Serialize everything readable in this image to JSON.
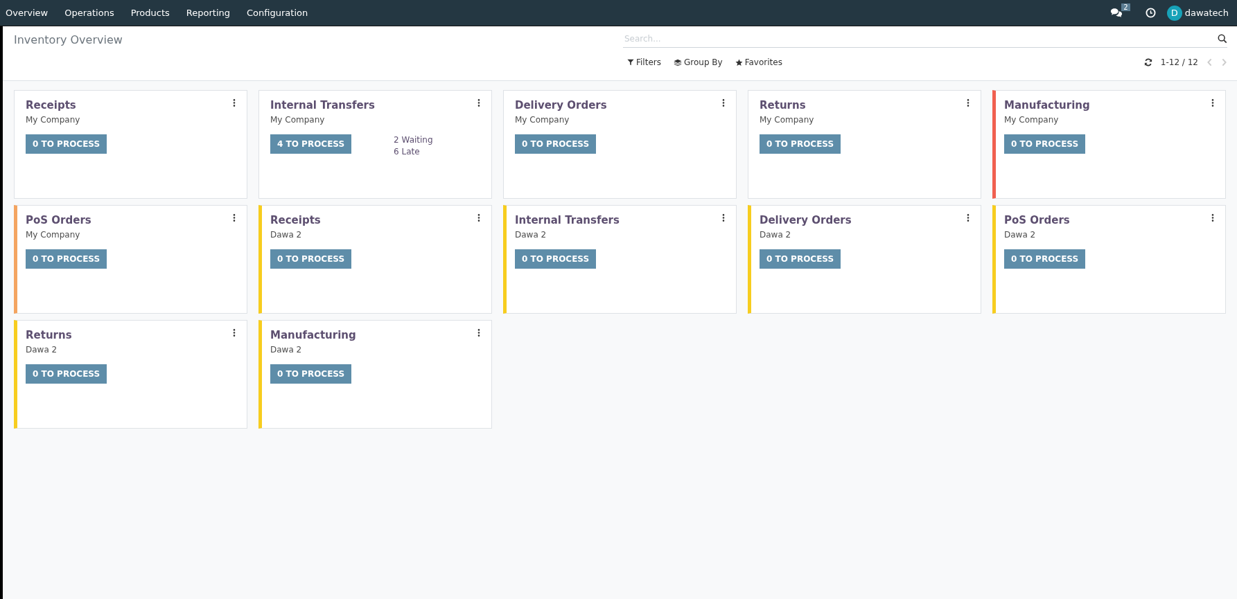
{
  "menu": [
    {
      "label": "Overview"
    },
    {
      "label": "Operations"
    },
    {
      "label": "Products"
    },
    {
      "label": "Reporting"
    },
    {
      "label": "Configuration"
    }
  ],
  "systray": {
    "chat_count": "2",
    "user_initial": "D",
    "user_name": "dawatech"
  },
  "control_panel": {
    "title": "Inventory Overview",
    "search": {
      "placeholder": "Search..."
    },
    "filters": [
      "Filters",
      "Group By",
      "Favorites"
    ],
    "pager": {
      "range": "1-12 / 12",
      "prev_disabled": true,
      "next_disabled": true
    }
  },
  "cards": [
    {
      "title": "Receipts",
      "company": "My Company",
      "button": "0 TO PROCESS"
    },
    {
      "title": "Internal Transfers",
      "company": "My Company",
      "button": "4 TO PROCESS",
      "notes": [
        "2 Waiting",
        "6 Late"
      ]
    },
    {
      "title": "Delivery Orders",
      "company": "My Company",
      "button": "0 TO PROCESS"
    },
    {
      "title": "Returns",
      "company": "My Company",
      "button": "0 TO PROCESS"
    },
    {
      "title": "Manufacturing",
      "company": "My Company",
      "button": "0 TO PROCESS",
      "color": "#f06050"
    },
    {
      "title": "PoS Orders",
      "company": "My Company",
      "button": "0 TO PROCESS",
      "color": "#f4a460"
    },
    {
      "title": "Receipts",
      "company": "Dawa 2",
      "button": "0 TO PROCESS",
      "color": "#f7cd1f"
    },
    {
      "title": "Internal Transfers",
      "company": "Dawa 2",
      "button": "0 TO PROCESS",
      "color": "#f7cd1f"
    },
    {
      "title": "Delivery Orders",
      "company": "Dawa 2",
      "button": "0 TO PROCESS",
      "color": "#f7cd1f"
    },
    {
      "title": "PoS Orders",
      "company": "Dawa 2",
      "button": "0 TO PROCESS",
      "color": "#f7cd1f"
    },
    {
      "title": "Returns",
      "company": "Dawa 2",
      "button": "0 TO PROCESS",
      "color": "#f7cd1f"
    },
    {
      "title": "Manufacturing",
      "company": "Dawa 2",
      "button": "0 TO PROCESS",
      "color": "#f7cd1f"
    }
  ]
}
